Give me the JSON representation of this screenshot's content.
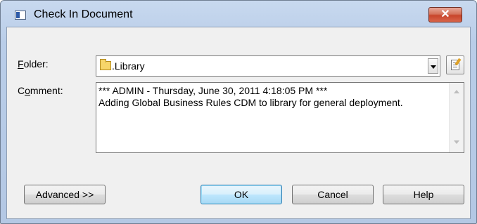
{
  "window": {
    "title": "Check In Document",
    "close_label": "✕"
  },
  "form": {
    "folder_label_accel": "F",
    "folder_label_rest": "older:",
    "folder_value": ".Library",
    "comment_label_pre": "C",
    "comment_label_accel": "o",
    "comment_label_rest": "mment:",
    "comment_text": "*** ADMIN - Thursday, June 30, 2011 4:18:05 PM ***\nAdding Global Business Rules CDM to library for general deployment."
  },
  "buttons": {
    "advanced": "Advanced >>",
    "ok": "OK",
    "cancel": "Cancel",
    "help": "Help"
  }
}
